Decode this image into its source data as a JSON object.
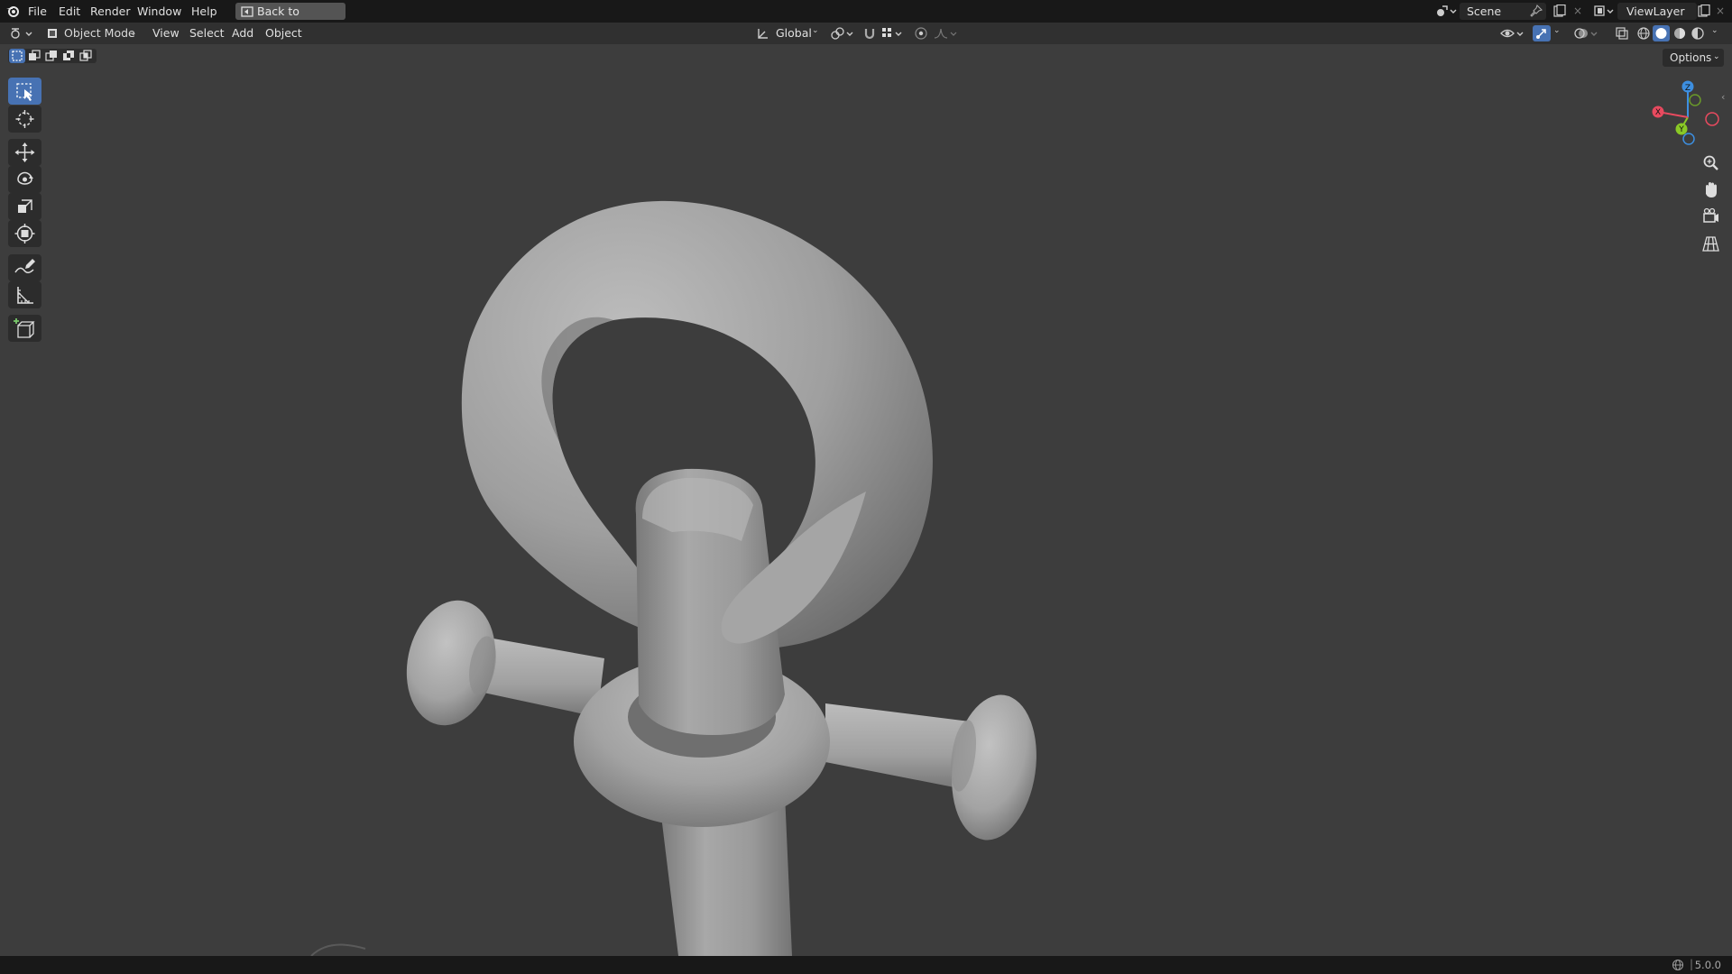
{
  "topbar": {
    "menus": [
      "File",
      "Edit",
      "Render",
      "Window",
      "Help"
    ],
    "back_label": "Back to Previous",
    "scene": "Scene",
    "view_layer": "ViewLayer"
  },
  "header": {
    "mode": "Object Mode",
    "menus": [
      "View",
      "Select",
      "Add",
      "Object"
    ],
    "orientation": "Global",
    "options_label": "Options"
  },
  "toolbar": {
    "tools": [
      "select-box",
      "cursor",
      "move",
      "rotate",
      "scale",
      "transform",
      "annotate",
      "measure",
      "add-cube"
    ],
    "active": "select-box"
  },
  "gizmo": {
    "axes": [
      "X",
      "Y",
      "Z"
    ],
    "colors": {
      "x": "#e84a5f",
      "y": "#8ac926",
      "z": "#3d8fe0"
    }
  },
  "status": {
    "version": "5.0.0"
  },
  "colors": {
    "accent": "#4772b3",
    "viewport_bg": "#3d3d3d",
    "model": "#a9a9a9"
  }
}
